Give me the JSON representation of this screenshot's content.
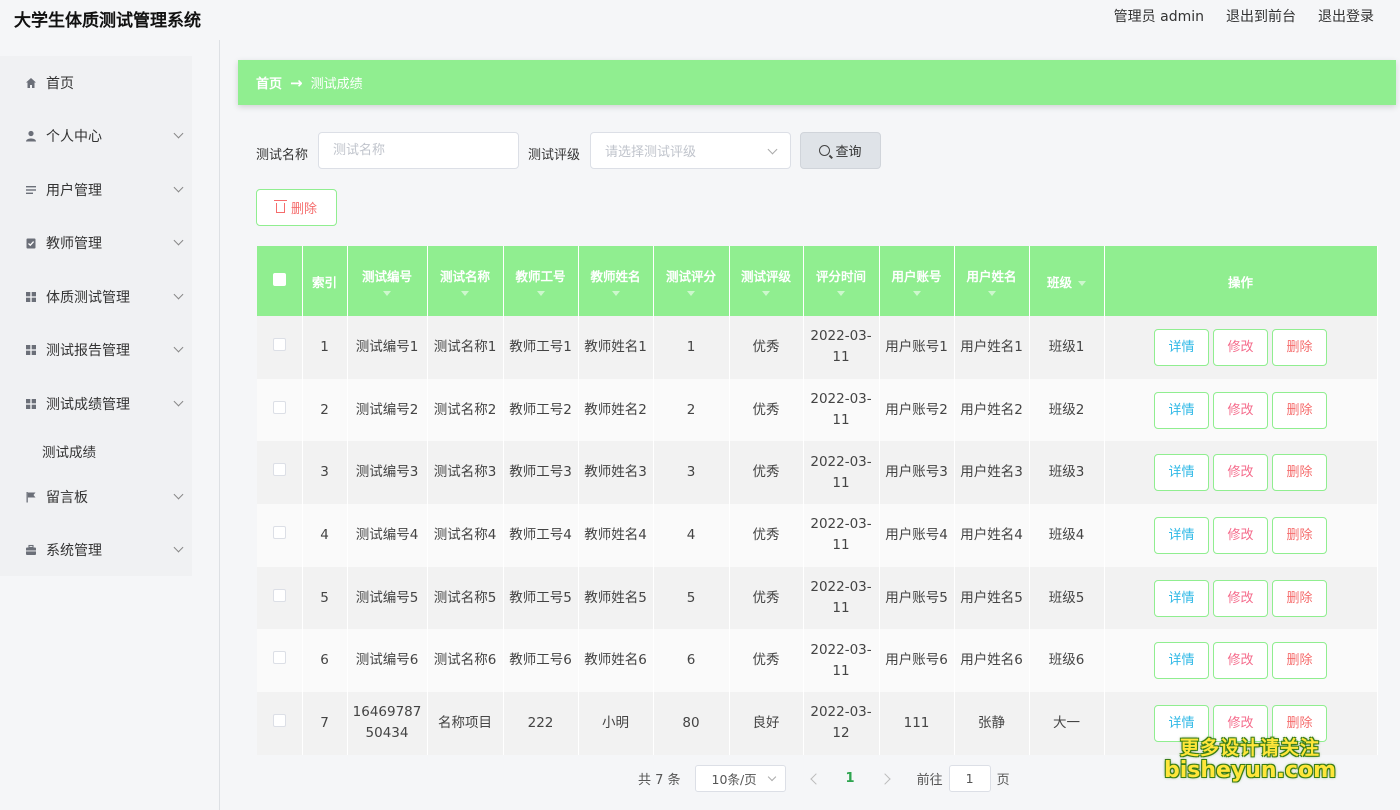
{
  "header": {
    "app_title": "大学生体质测试管理系统",
    "user_label": "管理员 admin",
    "to_front_label": "退出到前台",
    "logout_label": "退出登录"
  },
  "sidebar": {
    "items": [
      {
        "label": "首页",
        "icon": "home-icon"
      },
      {
        "label": "个人中心",
        "icon": "user-icon"
      },
      {
        "label": "用户管理",
        "icon": "list-icon"
      },
      {
        "label": "教师管理",
        "icon": "clipboard-icon"
      },
      {
        "label": "体质测试管理",
        "icon": "grid-icon"
      },
      {
        "label": "测试报告管理",
        "icon": "grid-icon"
      },
      {
        "label": "测试成绩管理",
        "icon": "grid-icon"
      },
      {
        "label": "留言板",
        "icon": "flag-icon"
      },
      {
        "label": "系统管理",
        "icon": "briefcase-icon"
      }
    ],
    "sub_item": "测试成绩"
  },
  "breadcrumb": {
    "home": "首页",
    "current": "测试成绩"
  },
  "search": {
    "name_label": "测试名称",
    "name_placeholder": "测试名称",
    "grade_label": "测试评级",
    "grade_placeholder": "请选择测试评级",
    "query_label": "查询"
  },
  "toolbar": {
    "delete_label": "删除"
  },
  "table": {
    "headers": {
      "index": "索引",
      "code": "测试编号",
      "name": "测试名称",
      "teacher_no": "教师工号",
      "teacher_name": "教师姓名",
      "score": "测试评分",
      "grade": "测试评级",
      "time": "评分时间",
      "account": "用户账号",
      "username": "用户姓名",
      "class": "班级",
      "ops": "操作"
    },
    "ops": {
      "detail": "详情",
      "edit": "修改",
      "delete": "删除"
    },
    "rows": [
      {
        "index": "1",
        "code": "测试编号1",
        "name": "测试名称1",
        "teacher_no": "教师工号1",
        "teacher_name": "教师姓名1",
        "score": "1",
        "grade": "优秀",
        "time": "2022-03-11",
        "account": "用户账号1",
        "username": "用户姓名1",
        "class": "班级1"
      },
      {
        "index": "2",
        "code": "测试编号2",
        "name": "测试名称2",
        "teacher_no": "教师工号2",
        "teacher_name": "教师姓名2",
        "score": "2",
        "grade": "优秀",
        "time": "2022-03-11",
        "account": "用户账号2",
        "username": "用户姓名2",
        "class": "班级2"
      },
      {
        "index": "3",
        "code": "测试编号3",
        "name": "测试名称3",
        "teacher_no": "教师工号3",
        "teacher_name": "教师姓名3",
        "score": "3",
        "grade": "优秀",
        "time": "2022-03-11",
        "account": "用户账号3",
        "username": "用户姓名3",
        "class": "班级3"
      },
      {
        "index": "4",
        "code": "测试编号4",
        "name": "测试名称4",
        "teacher_no": "教师工号4",
        "teacher_name": "教师姓名4",
        "score": "4",
        "grade": "优秀",
        "time": "2022-03-11",
        "account": "用户账号4",
        "username": "用户姓名4",
        "class": "班级4"
      },
      {
        "index": "5",
        "code": "测试编号5",
        "name": "测试名称5",
        "teacher_no": "教师工号5",
        "teacher_name": "教师姓名5",
        "score": "5",
        "grade": "优秀",
        "time": "2022-03-11",
        "account": "用户账号5",
        "username": "用户姓名5",
        "class": "班级5"
      },
      {
        "index": "6",
        "code": "测试编号6",
        "name": "测试名称6",
        "teacher_no": "教师工号6",
        "teacher_name": "教师姓名6",
        "score": "6",
        "grade": "优秀",
        "time": "2022-03-11",
        "account": "用户账号6",
        "username": "用户姓名6",
        "class": "班级6"
      },
      {
        "index": "7",
        "code": "1646978750434",
        "name": "名称项目",
        "teacher_no": "222",
        "teacher_name": "小明",
        "score": "80",
        "grade": "良好",
        "time": "2022-03-12",
        "account": "111",
        "username": "张静",
        "class": "大一"
      }
    ]
  },
  "pagination": {
    "total": "共 7 条",
    "page_size": "10条/页",
    "current_page": "1",
    "goto_label": "前往",
    "goto_value": "1",
    "page_suffix": "页"
  },
  "watermark": {
    "line1": "更多设计请关注",
    "line2": "bisheyun.com"
  },
  "colors": {
    "accent": "#90ee90",
    "detail": "#2eb8e6",
    "edit": "#f56c8c",
    "delete": "#f56c6c"
  }
}
